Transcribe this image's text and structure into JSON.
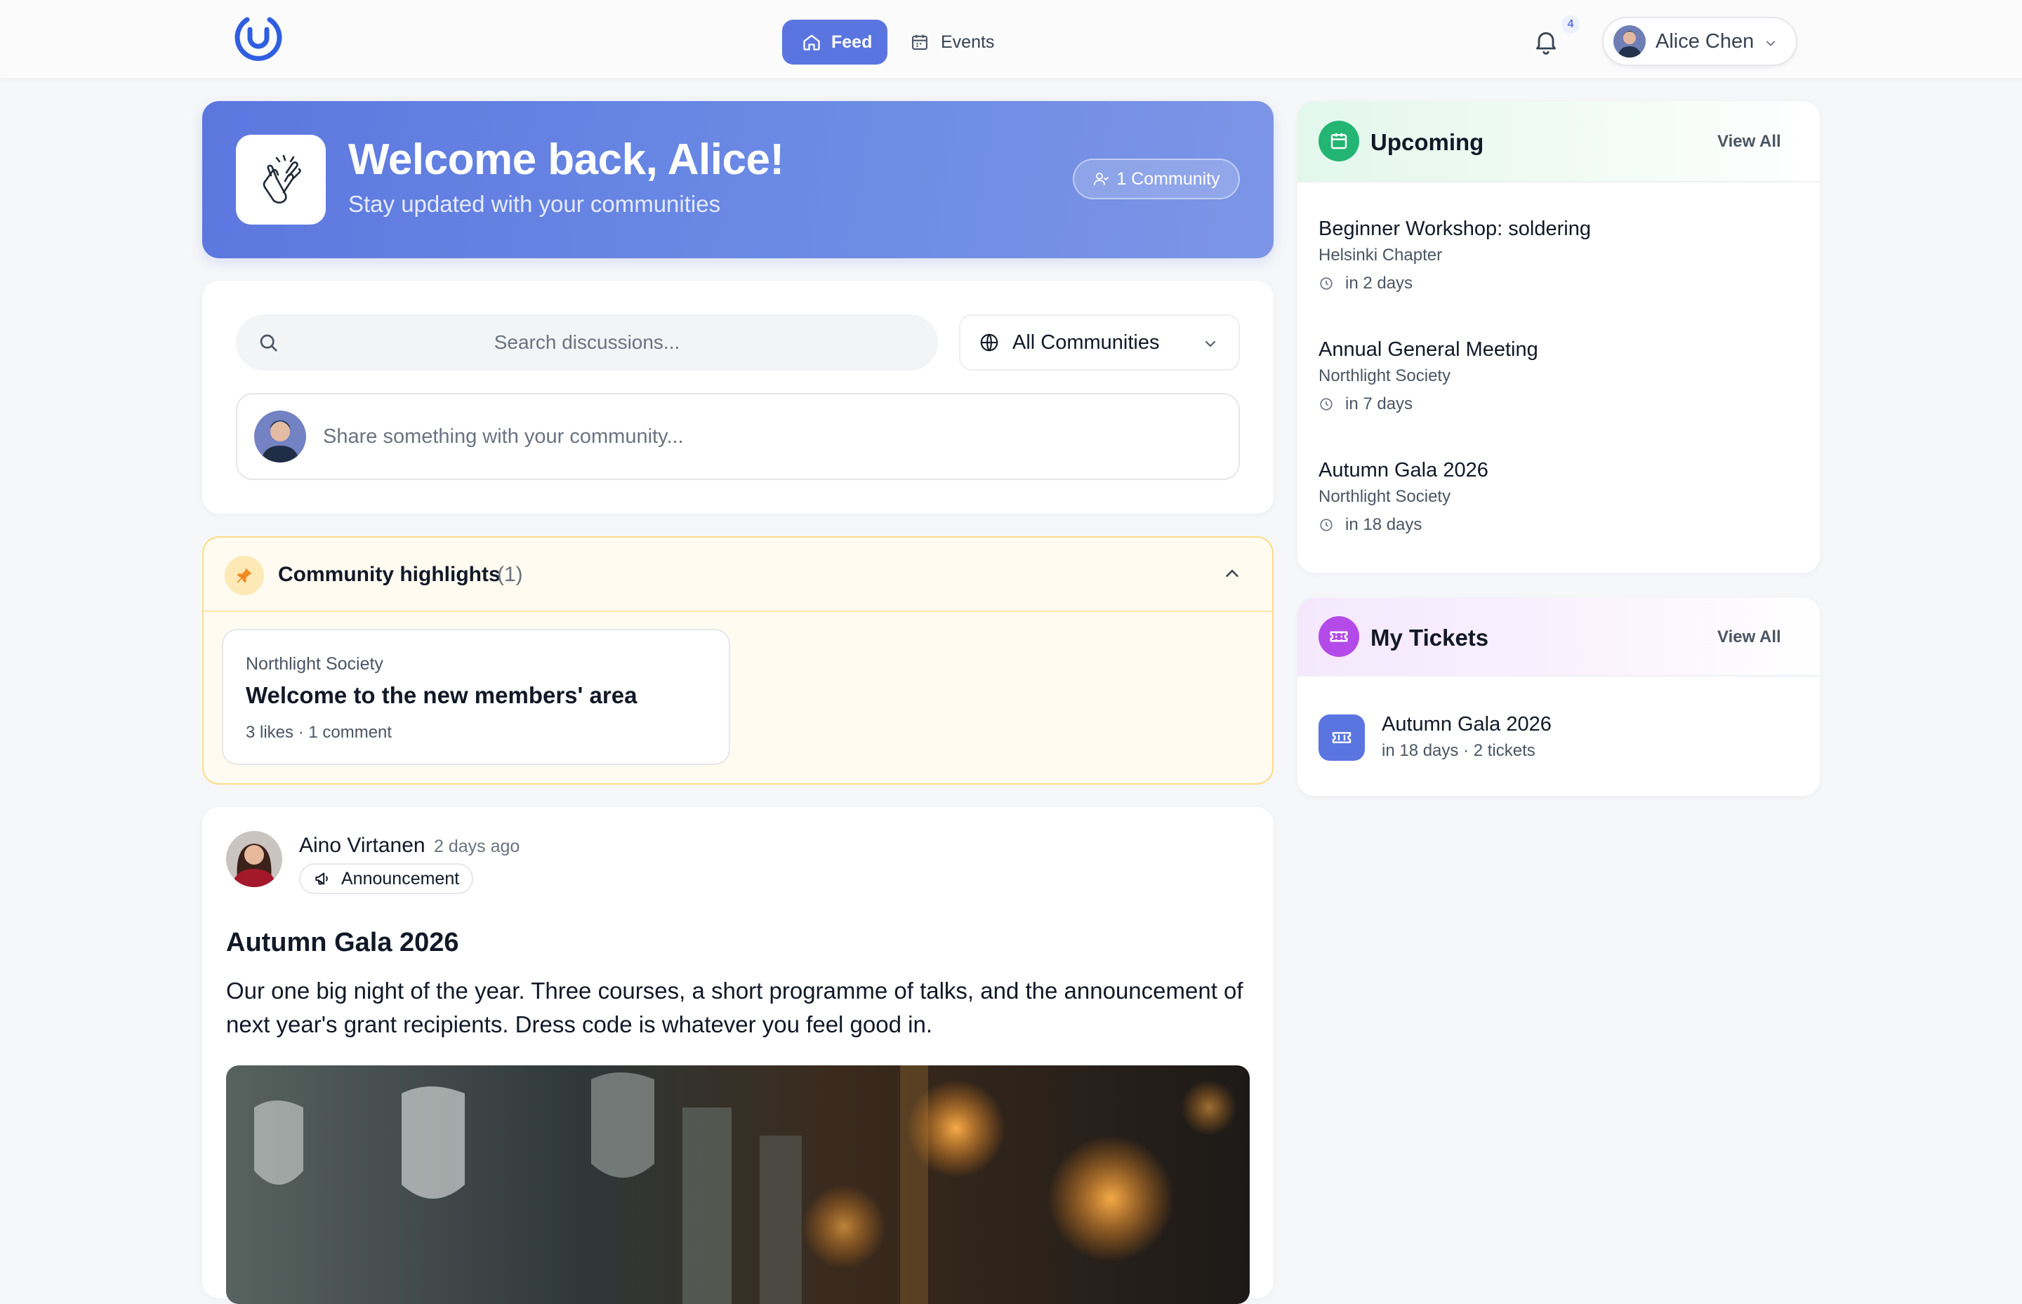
{
  "nav": {
    "feed": "Feed",
    "events": "Events",
    "notification_count": "4",
    "user_name": "Alice Chen"
  },
  "welcome": {
    "title": "Welcome back, Alice!",
    "subtitle": "Stay updated with your communities",
    "community_count": "1 Community"
  },
  "search": {
    "placeholder": "Search discussions...",
    "filter_value": "All Communities",
    "composer_placeholder": "Share something with your community..."
  },
  "highlights": {
    "title": "Community highlights",
    "count": "(1)",
    "items": [
      {
        "community": "Northlight Society",
        "title": "Welcome to the new members' area",
        "meta": "3 likes · 1 comment"
      }
    ]
  },
  "post": {
    "author": "Aino Virtanen",
    "time": "2 days ago",
    "tag": "Announcement",
    "title": "Autumn Gala 2026",
    "body": "Our one big night of the year. Three courses, a short programme of talks, and the announcement of next year's grant recipients. Dress code is whatever you feel good in."
  },
  "upcoming": {
    "title": "Upcoming",
    "view_all": "View All",
    "events": [
      {
        "title": "Beginner Workshop: soldering",
        "community": "Helsinki Chapter",
        "when": "in 2 days"
      },
      {
        "title": "Annual General Meeting",
        "community": "Northlight Society",
        "when": "in 7 days"
      },
      {
        "title": "Autumn Gala 2026",
        "community": "Northlight Society",
        "when": "in 18 days"
      }
    ]
  },
  "tickets": {
    "title": "My Tickets",
    "view_all": "View All",
    "items": [
      {
        "title": "Autumn Gala 2026",
        "meta": "in 18 days · 2 tickets"
      }
    ]
  },
  "colors": {
    "accent": "#5b75e0",
    "upcoming_accent": "#22b573",
    "tickets_accent": "#b44be8",
    "highlight_accent": "#f08a24"
  }
}
